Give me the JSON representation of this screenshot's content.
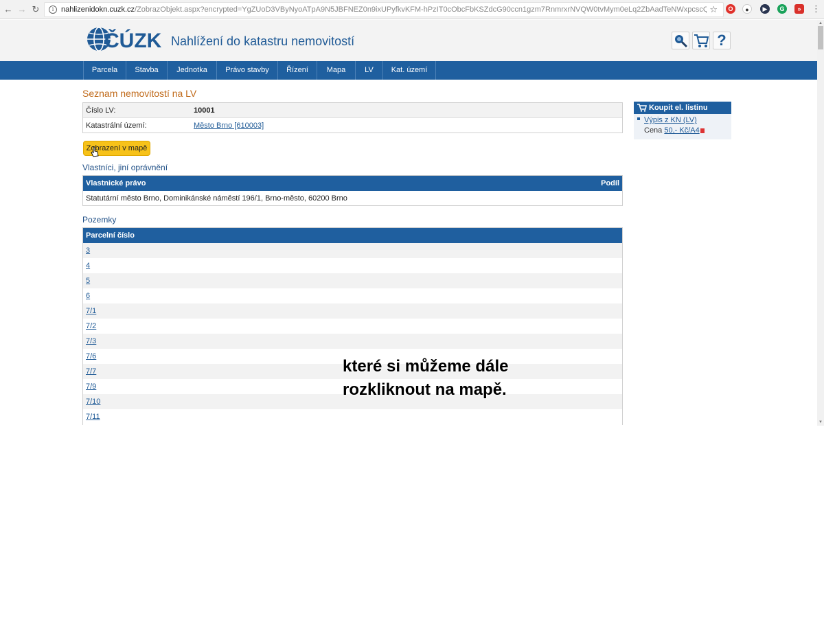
{
  "browser": {
    "url_host": "nahlizenidokn.cuzk.cz",
    "url_path": "/ZobrazObjekt.aspx?encrypted=YgZUoD3VByNyoATpA9N5JBFNEZ0n9ixUPyfkvKFM-hPzIT0cObcFbKSZdcG90ccn1gzm7RnmrxrNVQW0tvMym0eLq2ZbAadTeNWxpcscQPc..."
  },
  "header": {
    "logo_text": "ČÚZK",
    "site_title": "Nahlížení do katastru nemovitostí",
    "help_label": "?"
  },
  "nav": {
    "items": [
      "Parcela",
      "Stavba",
      "Jednotka",
      "Právo stavby",
      "Řízení",
      "Mapa",
      "LV",
      "Kat. území"
    ]
  },
  "page": {
    "title": "Seznam nemovitostí na LV",
    "lv_label": "Číslo LV:",
    "lv_value": "10001",
    "ku_label": "Katastrální území:",
    "ku_value": "Město Brno [610003]",
    "map_button": "Zobrazení v mapě"
  },
  "owners": {
    "section_title": "Vlastníci, jiní oprávnění",
    "col_right": "Vlastnické právo",
    "col_share": "Podíl",
    "owner": "Statutární město Brno, Dominikánské náměstí 196/1, Brno-město, 60200 Brno"
  },
  "parcels": {
    "section_title": "Pozemky",
    "col_header": "Parcelní číslo",
    "rows": [
      "3",
      "4",
      "5",
      "6",
      "7/1",
      "7/2",
      "7/3",
      "7/6",
      "7/7",
      "7/9",
      "7/10",
      "7/11"
    ]
  },
  "sidebar": {
    "buy_title": "Koupit el. listinu",
    "buy_item": "Výpis z KN (LV)",
    "price_label": "Cena",
    "price_value": "50,- Kč/A4"
  },
  "caption": {
    "line1": "které si můžeme dále",
    "line2": "rozkliknout na mapě."
  },
  "colors": {
    "brand_blue": "#1f5f9f",
    "title_orange": "#c06a1a",
    "button_yellow": "#f7c21a"
  }
}
